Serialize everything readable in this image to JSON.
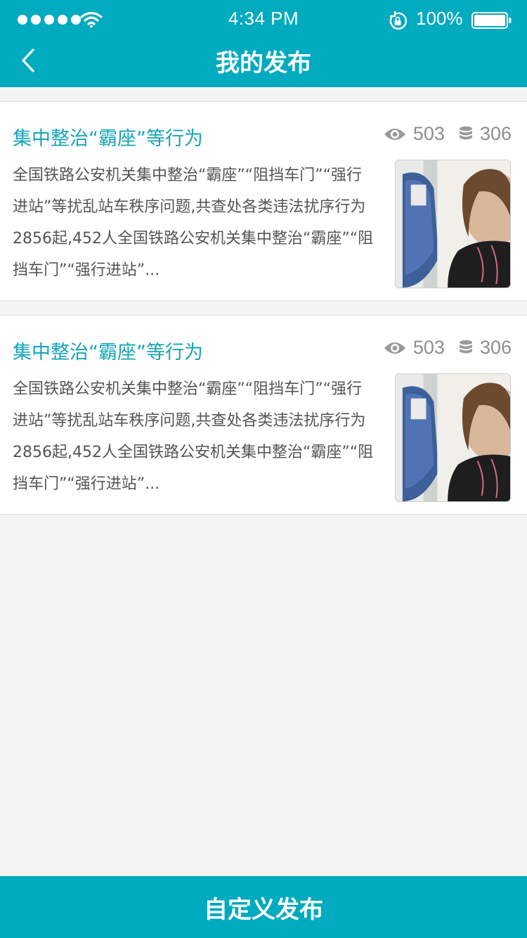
{
  "status_bar": {
    "time": "4:34 PM",
    "battery_percent": "100%",
    "icons": [
      "signal-dots-icon",
      "wifi-icon",
      "rotation-lock-icon",
      "battery-icon"
    ]
  },
  "nav": {
    "back_icon": "chevron-left-icon",
    "title": "我的发布"
  },
  "posts": [
    {
      "title": "集中整治“霸座”等行为",
      "views": "503",
      "count": "306",
      "excerpt": "全国铁路公安机关集中整治“霸座”“阻挡车门”“强行进站”等扰乱站车秩序问题,共查处各类违法扰序行为2856起,452人全国铁路公安机关集中整治“霸座”“阻挡车门”“强行进站”...",
      "thumbnail": "photo-woman-on-train-seat"
    },
    {
      "title": "集中整治“霸座”等行为",
      "views": "503",
      "count": "306",
      "excerpt": "全国铁路公安机关集中整治“霸座”“阻挡车门”“强行进站”等扰乱站车秩序问题,共查处各类违法扰序行为2856起,452人全国铁路公安机关集中整治“霸座”“阻挡车门”“强行进站”...",
      "thumbnail": "photo-woman-on-train-seat"
    }
  ],
  "bottom_button": {
    "label": "自定义发布"
  },
  "colors": {
    "accent": "#00aabf",
    "title_text": "#15a5b8",
    "body_text": "#555555",
    "meta_text": "#8e8e8e",
    "background": "#f3f3f3"
  }
}
